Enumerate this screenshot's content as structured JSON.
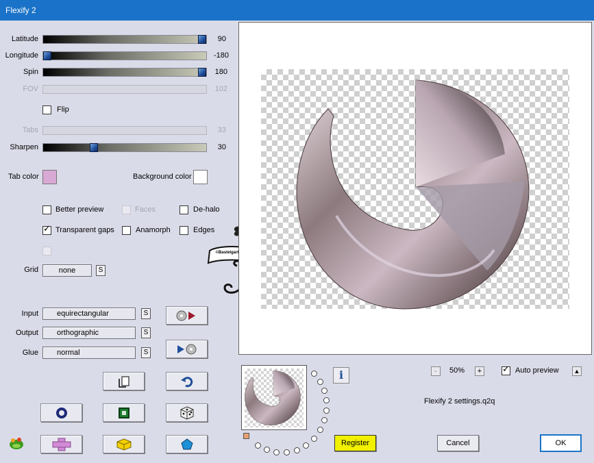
{
  "window": {
    "title": "Flexify 2"
  },
  "sliders": {
    "latitude": {
      "label": "Latitude",
      "value": "90",
      "fraction": 1.0
    },
    "longitude": {
      "label": "Longitude",
      "value": "-180",
      "fraction": 0.0
    },
    "spin": {
      "label": "Spin",
      "value": "180",
      "fraction": 1.0
    },
    "fov": {
      "label": "FOV",
      "value": "102"
    },
    "tabs": {
      "label": "Tabs",
      "value": "33"
    },
    "sharpen": {
      "label": "Sharpen",
      "value": "30",
      "fraction": 0.3
    }
  },
  "flip": {
    "label": "Flip",
    "checked": false
  },
  "colors": {
    "tab_label": "Tab color",
    "tab_color": "#d9a9d6",
    "background_label": "Background color",
    "background_color": "#ffffff",
    "accent_titlebar": "#1a73c8",
    "register_color": "#f0f000"
  },
  "options": {
    "better_preview": "Better preview",
    "faces": "Faces",
    "de_halo": "De-halo",
    "transparent_gaps": "Transparent gaps",
    "anamorph": "Anamorph",
    "edges": "Edges",
    "transparent_gaps_checked": true
  },
  "grid": {
    "label": "Grid",
    "value": "none",
    "s": "S"
  },
  "input": {
    "label": "Input",
    "value": "equirectangular",
    "s": "S"
  },
  "output": {
    "label": "Output",
    "value": "orthographic",
    "s": "S"
  },
  "glue": {
    "label": "Glue",
    "value": "normal",
    "s": "S"
  },
  "zoom": {
    "minus": "-",
    "value": "50%",
    "plus": "+"
  },
  "auto_preview": {
    "label": "Auto preview",
    "checked": true,
    "up": "▲"
  },
  "settings_file": "Flexify 2 settings.q2q",
  "watermark": {
    "text": "©Bastelgarten Wien"
  },
  "buttons": {
    "info": "i",
    "register": "Register",
    "cancel": "Cancel",
    "ok": "OK"
  },
  "icons": {
    "play_from": "play-from-sphere-icon",
    "play_to": "play-to-sphere-icon",
    "copy": "copy-icon",
    "undo": "undo-icon",
    "ring": "ring-icon",
    "square": "square-icon",
    "dice": "dice-icon",
    "cross": "cross-icon",
    "cube": "cube-icon",
    "pentagon": "pentagon-icon",
    "logo": "frog-logo-icon"
  }
}
